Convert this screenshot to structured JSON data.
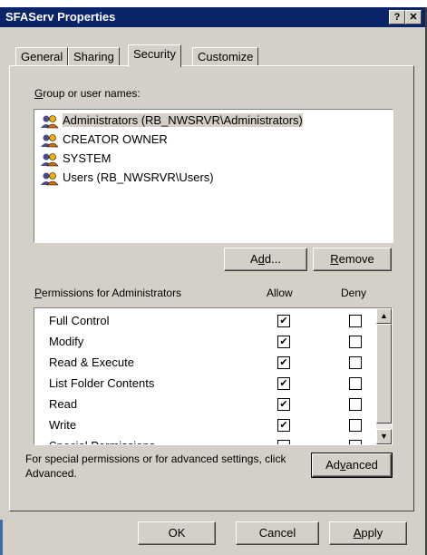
{
  "window": {
    "title": "SFAServ Properties",
    "help_button": "?",
    "close_button": "✕"
  },
  "tabs": [
    {
      "label": "General",
      "active": false
    },
    {
      "label": "Sharing",
      "active": false
    },
    {
      "label": "Security",
      "active": true
    },
    {
      "label": "Customize",
      "active": false
    }
  ],
  "security": {
    "group_label_prefix": "G",
    "group_label_rest": "roup or user names:",
    "users": [
      {
        "name": "Administrators (RB_NWSRVR\\Administrators)",
        "selected": true
      },
      {
        "name": "CREATOR OWNER",
        "selected": false
      },
      {
        "name": "SYSTEM",
        "selected": false
      },
      {
        "name": "Users (RB_NWSRVR\\Users)",
        "selected": false
      }
    ],
    "add_button": {
      "pre": "A",
      "u": "d",
      "post": "d..."
    },
    "remove_button": {
      "pre": "",
      "u": "R",
      "post": "emove"
    },
    "permissions_label_prefix": "P",
    "permissions_label_rest": "ermissions for Administrators",
    "allow_header": "Allow",
    "deny_header": "Deny",
    "permissions": [
      {
        "name": "Full Control",
        "allow": true,
        "deny": false
      },
      {
        "name": "Modify",
        "allow": true,
        "deny": false
      },
      {
        "name": "Read & Execute",
        "allow": true,
        "deny": false
      },
      {
        "name": "List Folder Contents",
        "allow": true,
        "deny": false
      },
      {
        "name": "Read",
        "allow": true,
        "deny": false
      },
      {
        "name": "Write",
        "allow": true,
        "deny": false
      },
      {
        "name": "Special Permissions",
        "allow": false,
        "deny": false
      }
    ],
    "advanced_text": "For special permissions or for advanced settings, click Advanced.",
    "advanced_button": {
      "pre": "Ad",
      "u": "v",
      "post": "anced"
    }
  },
  "footer": {
    "ok_label": "OK",
    "cancel_label": "Cancel",
    "apply_button": {
      "pre": "",
      "u": "A",
      "post": "pply"
    }
  },
  "colors": {
    "titlebar": "#0a246a",
    "face": "#d4d0c8"
  }
}
